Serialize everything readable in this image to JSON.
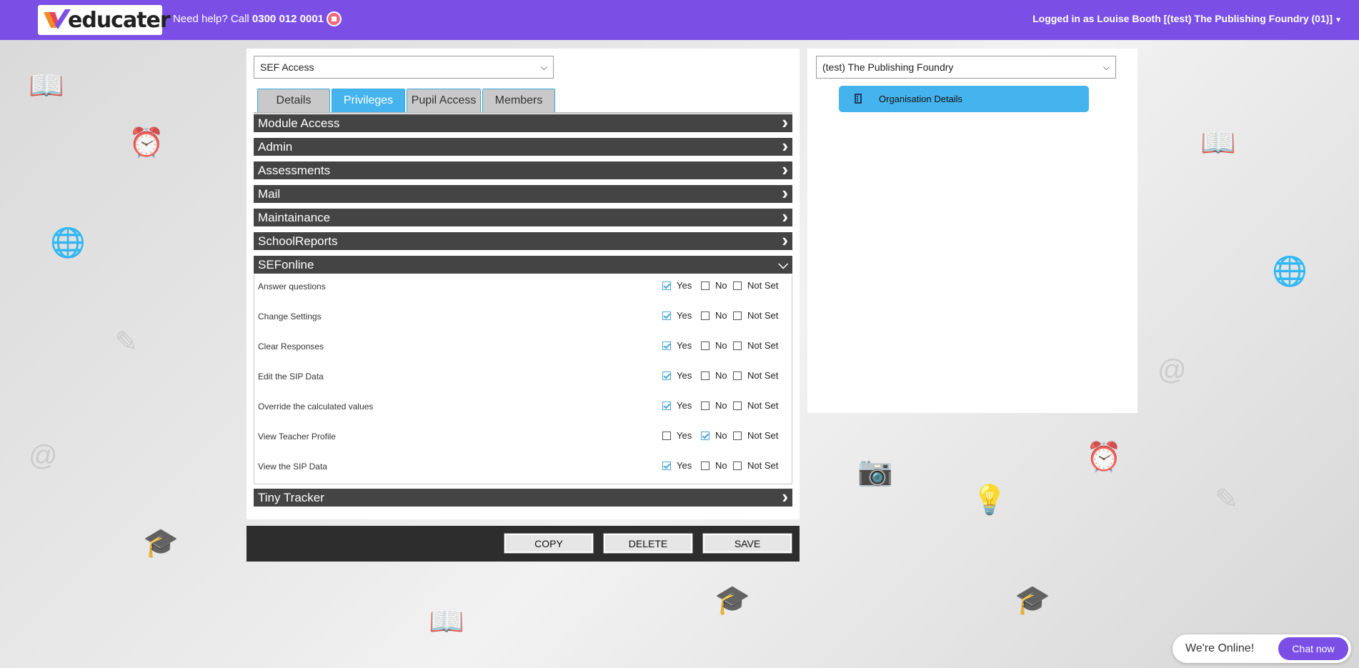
{
  "header": {
    "brand": "educater",
    "help_prefix": "Need help? Call ",
    "help_phone": "0300 012 0001",
    "user_label": "Logged in as Louise Booth [(test) The Publishing Foundry (01)]"
  },
  "main": {
    "role_select": "SEF Access",
    "tabs": [
      {
        "label": "Details"
      },
      {
        "label": "Privileges"
      },
      {
        "label": "Pupil Access"
      },
      {
        "label": "Members"
      }
    ],
    "active_tab": "Privileges",
    "sections": [
      {
        "label": "Module Access",
        "expanded": false
      },
      {
        "label": "Admin",
        "expanded": false
      },
      {
        "label": "Assessments",
        "expanded": false
      },
      {
        "label": "Mail",
        "expanded": false
      },
      {
        "label": "Maintainance",
        "expanded": false
      },
      {
        "label": "SchoolReports",
        "expanded": false
      },
      {
        "label": "SEFonline",
        "expanded": true
      },
      {
        "label": "Tiny Tracker",
        "expanded": false
      }
    ],
    "option_labels": {
      "yes": "Yes",
      "no": "No",
      "not_set": "Not Set"
    },
    "privileges": [
      {
        "name": "Answer questions",
        "value": "yes"
      },
      {
        "name": "Change Settings",
        "value": "yes"
      },
      {
        "name": "Clear Responses",
        "value": "yes"
      },
      {
        "name": "Edit the SIP Data",
        "value": "yes"
      },
      {
        "name": "Override the calculated values",
        "value": "yes"
      },
      {
        "name": "View Teacher Profile",
        "value": "no"
      },
      {
        "name": "View the SIP Data",
        "value": "yes"
      }
    ],
    "actions": {
      "copy": "COPY",
      "delete": "DELETE",
      "save": "SAVE"
    }
  },
  "side": {
    "org_select": "(test) The Publishing Foundry",
    "org_details_label": "Organisation Details"
  },
  "chat": {
    "status": "We're Online!",
    "button": "Chat now"
  },
  "colors": {
    "header": "#7b4fe6",
    "accent_blue": "#45b4ee",
    "section_bar": "#444444",
    "action_bar": "#2d2d2d"
  }
}
